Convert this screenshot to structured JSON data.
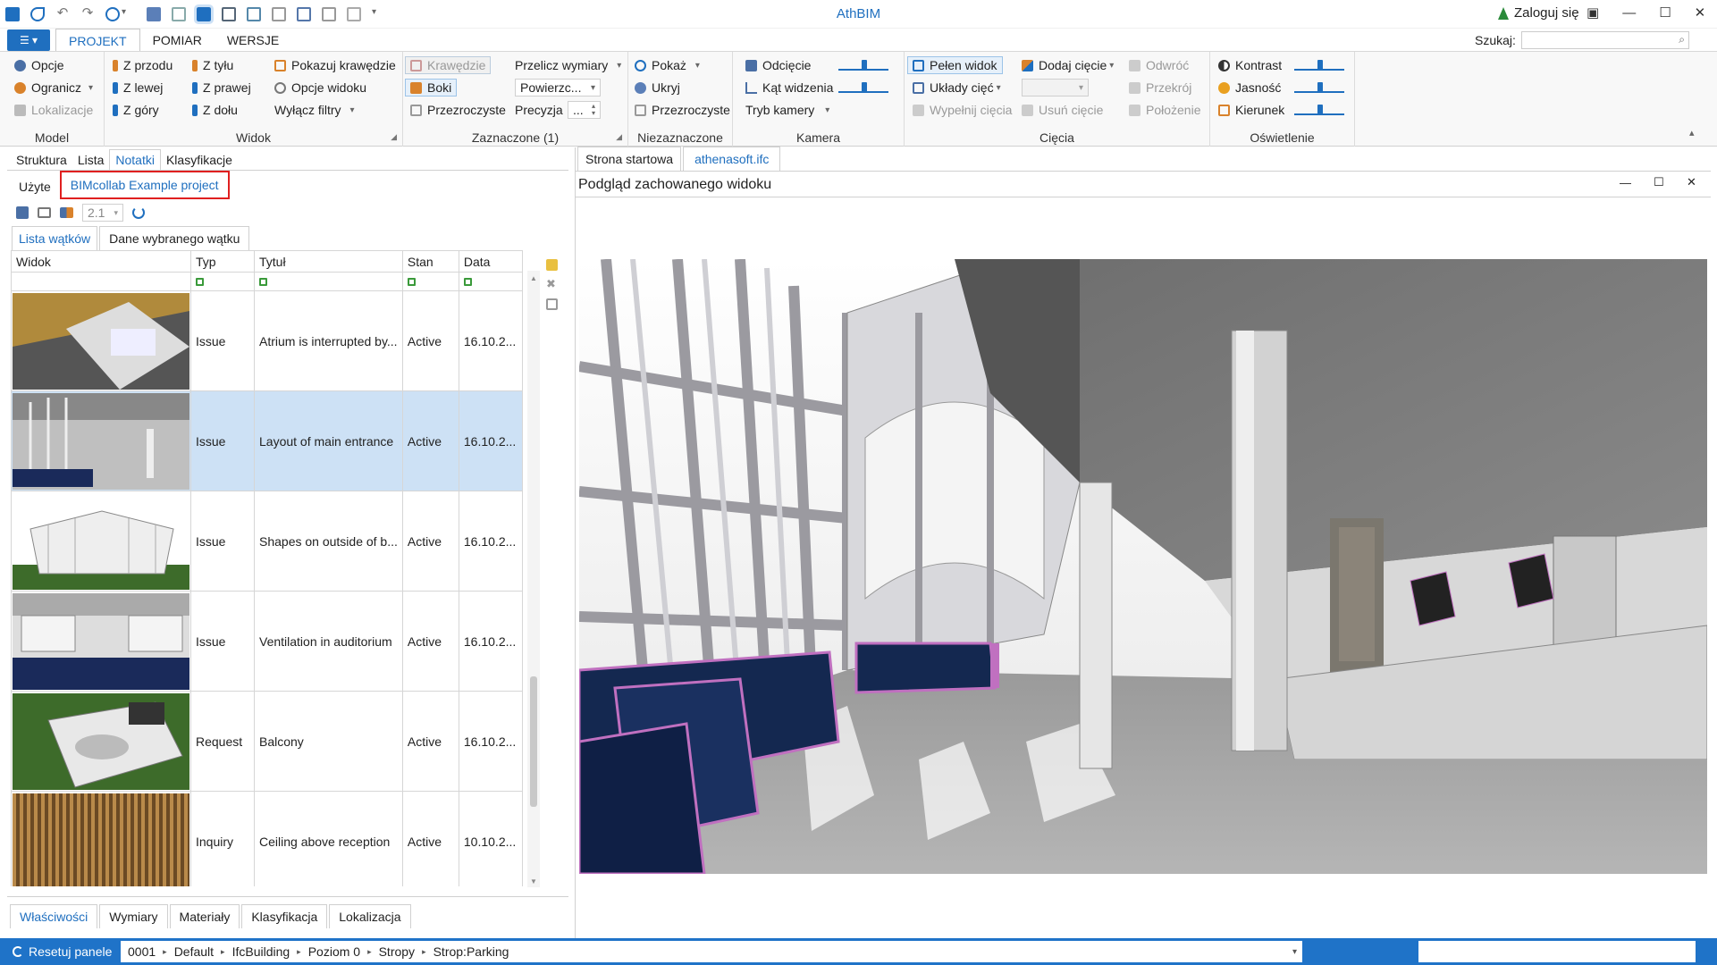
{
  "app": {
    "title": "AthBIM",
    "login": "Zaloguj się",
    "search_label": "Szukaj:",
    "search_value": ""
  },
  "ribbon_tabs": [
    "PROJEKT",
    "POMIAR",
    "WERSJE"
  ],
  "ribbon": {
    "model": {
      "label": "Model",
      "items": [
        "Opcje",
        "Ogranicz",
        "Lokalizacje"
      ]
    },
    "widok": {
      "label": "Widok",
      "col1": [
        "Z przodu",
        "Z lewej",
        "Z góry"
      ],
      "col2": [
        "Z tyłu",
        "Z prawej",
        "Z dołu"
      ],
      "col3": [
        "Pokazuj krawędzie",
        "Opcje widoku",
        "Wyłącz filtry"
      ]
    },
    "zaznaczone": {
      "label": "Zaznaczone (1)",
      "items": [
        "Krawędzie",
        "Boki",
        "Przezroczyste"
      ],
      "przelicz": "Przelicz wymiary",
      "przelicz_value": "Powierzc...",
      "precyzja": "Precyzja",
      "precyzja_value": "..."
    },
    "niezaznaczone": {
      "label": "Niezaznaczone",
      "items": [
        "Pokaż",
        "Ukryj",
        "Przezroczyste"
      ]
    },
    "kamera": {
      "label": "Kamera",
      "items": [
        "Odcięcie",
        "Kąt widzenia",
        "Tryb kamery"
      ]
    },
    "ciecia": {
      "label": "Cięcia",
      "col1": [
        "Pełen widok",
        "Układy cięć",
        "Wypełnij cięcia"
      ],
      "col2": [
        "Dodaj cięcie",
        "Usuń cięcie"
      ],
      "col3": [
        "Odwróć",
        "Przekrój",
        "Położenie"
      ]
    },
    "oswietlenie": {
      "label": "Oświetlenie",
      "items": [
        "Kontrast",
        "Jasność",
        "Kierunek"
      ]
    }
  },
  "left": {
    "tabs": [
      "Struktura",
      "Lista",
      "Notatki",
      "Klasyfikacje"
    ],
    "subtabs": [
      "Użyte",
      "BIMcollab Example project"
    ],
    "version": "2.1",
    "view_tabs": [
      "Lista wątków",
      "Dane wybranego wątku"
    ],
    "columns": [
      "Widok",
      "Typ",
      "Tytuł",
      "Stan",
      "Data"
    ],
    "rows": [
      {
        "typ": "Issue",
        "tytul": "Atrium is interrupted by...",
        "stan": "Active",
        "data": "16.10.2..."
      },
      {
        "typ": "Issue",
        "tytul": "Layout of main entrance",
        "stan": "Active",
        "data": "16.10.2..."
      },
      {
        "typ": "Issue",
        "tytul": "Shapes on outside of b...",
        "stan": "Active",
        "data": "16.10.2..."
      },
      {
        "typ": "Issue",
        "tytul": "Ventilation in auditorium",
        "stan": "Active",
        "data": "16.10.2..."
      },
      {
        "typ": "Request",
        "tytul": "Balcony",
        "stan": "Active",
        "data": "16.10.2..."
      },
      {
        "typ": "Inquiry",
        "tytul": "Ceiling above reception",
        "stan": "Active",
        "data": "10.10.2..."
      }
    ],
    "bottom_tabs": [
      "Właściwości",
      "Wymiary",
      "Materiały",
      "Klasyfikacja",
      "Lokalizacja"
    ]
  },
  "right": {
    "tabs": [
      "Strona startowa",
      "athenasoft.ifc"
    ],
    "view_title": "Podgląd zachowanego widoku"
  },
  "status": {
    "reset": "Resetuj panele",
    "crumbs": [
      "0001",
      "Default",
      "IfcBuilding",
      "Poziom 0",
      "Stropy",
      "Strop:Parking"
    ]
  },
  "colors": {
    "accent": "#1f6fbf",
    "status_bar": "#1f73c8",
    "selection": "#cde1f5",
    "highlight_box": "#e02020"
  }
}
